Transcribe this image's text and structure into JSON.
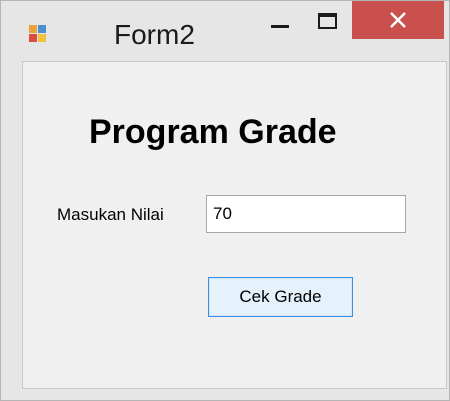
{
  "window": {
    "title": "Form2",
    "icon": "windows-form-icon",
    "controls": {
      "minimize_icon": "minimize-icon",
      "maximize_icon": "maximize-icon",
      "close_icon": "close-icon"
    },
    "colors": {
      "close_button": "#c9504d",
      "frame": "#e6e6e6",
      "client": "#f0f0f0",
      "button_border": "#3c8fd9"
    }
  },
  "form": {
    "heading": "Program Grade",
    "input_label": "Masukan Nilai",
    "input_value": "70",
    "button_label": "Cek Grade"
  }
}
